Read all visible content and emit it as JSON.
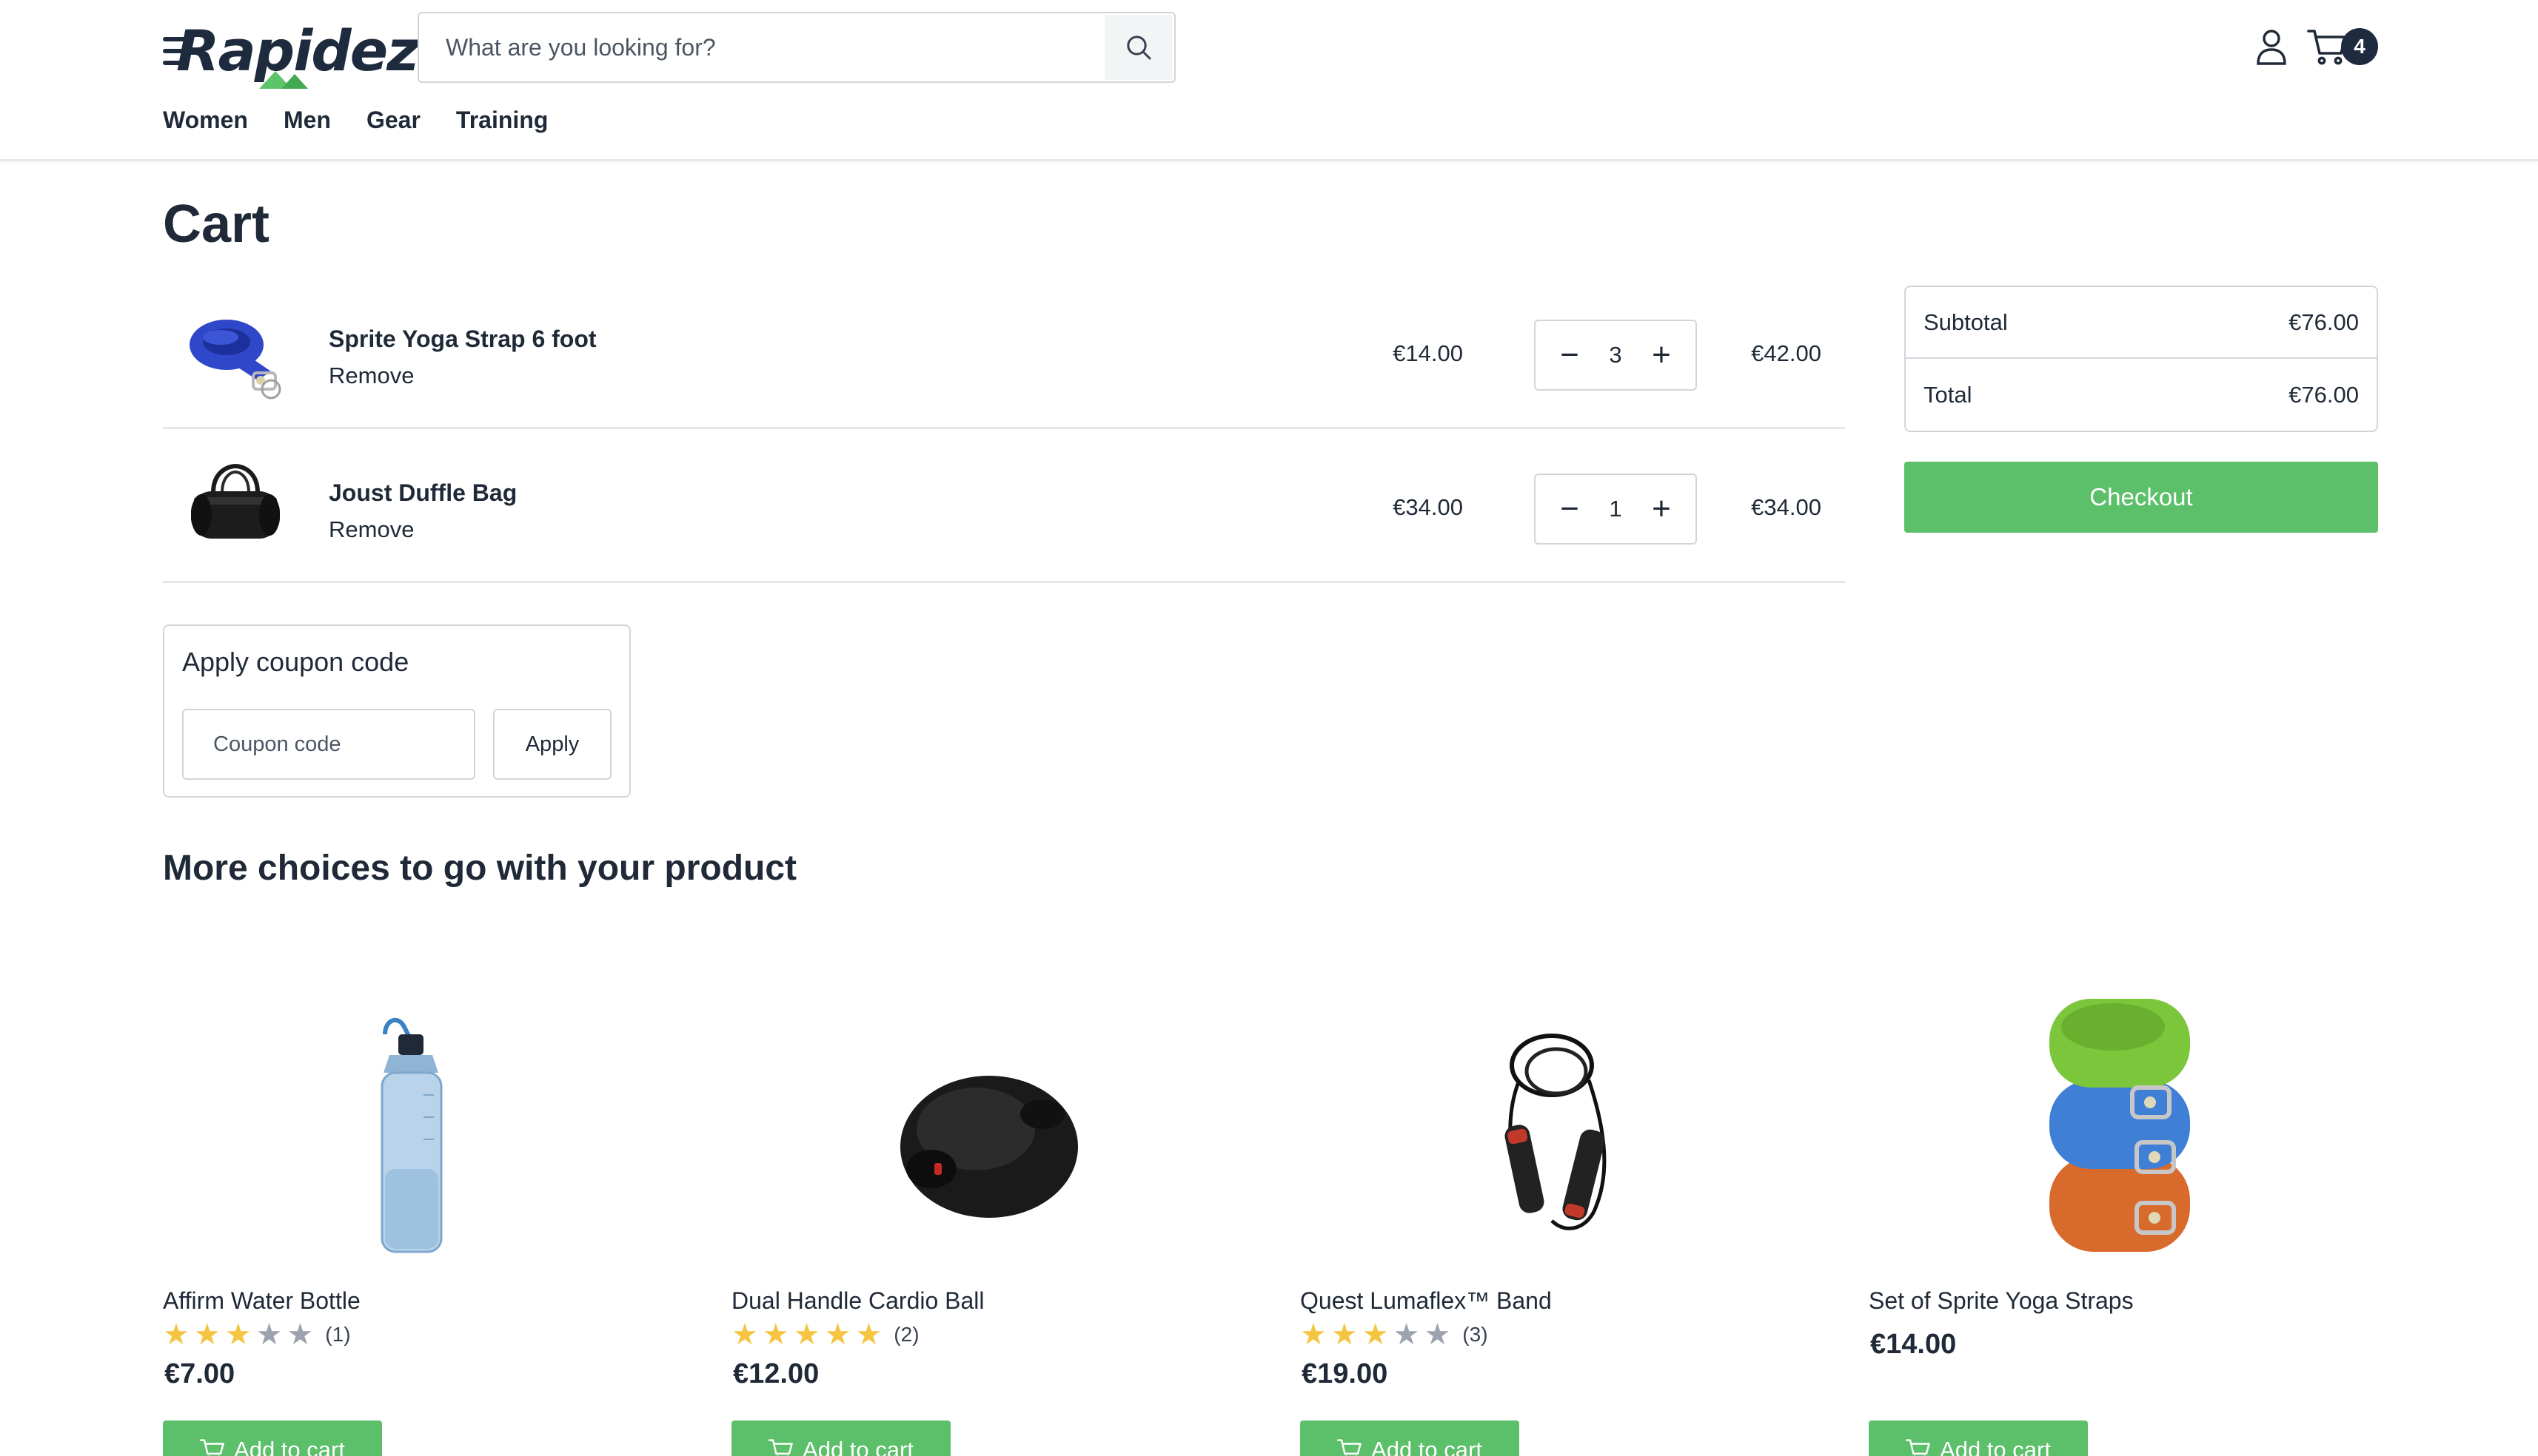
{
  "brand": {
    "name": "Rapidez"
  },
  "search": {
    "placeholder": "What are you looking for?"
  },
  "header": {
    "cart_count": "4"
  },
  "nav": {
    "items": [
      "Women",
      "Men",
      "Gear",
      "Training"
    ]
  },
  "page": {
    "title": "Cart"
  },
  "cart": {
    "remove_label": "Remove",
    "items": [
      {
        "name": "Sprite Yoga Strap 6 foot",
        "price": "€14.00",
        "qty": "3",
        "total": "€42.00",
        "icon": "blue-yoga-strap-image"
      },
      {
        "name": "Joust Duffle Bag",
        "price": "€34.00",
        "qty": "1",
        "total": "€34.00",
        "icon": "black-duffle-bag-image"
      }
    ]
  },
  "summary": {
    "subtotal_label": "Subtotal",
    "subtotal": "€76.00",
    "total_label": "Total",
    "total": "€76.00",
    "checkout_label": "Checkout"
  },
  "coupon": {
    "title": "Apply coupon code",
    "placeholder": "Coupon code",
    "apply_label": "Apply"
  },
  "recommendations": {
    "title": "More choices to go with your product",
    "add_label": "Add to cart",
    "products": [
      {
        "name": "Affirm Water Bottle",
        "rating": 3,
        "reviews": "(1)",
        "price": "€7.00"
      },
      {
        "name": "Dual Handle Cardio Ball",
        "rating": 5,
        "reviews": "(2)",
        "price": "€12.00"
      },
      {
        "name": "Quest Lumaflex™ Band",
        "rating": 3,
        "reviews": "(3)",
        "price": "€19.00"
      },
      {
        "name": "Set of Sprite Yoga Straps",
        "rating": null,
        "reviews": "",
        "price": "€14.00"
      }
    ]
  },
  "colors": {
    "accent": "#5cbf6a",
    "dark": "#1e2a3d",
    "star": "#f5c542",
    "border": "#d1d5db"
  }
}
